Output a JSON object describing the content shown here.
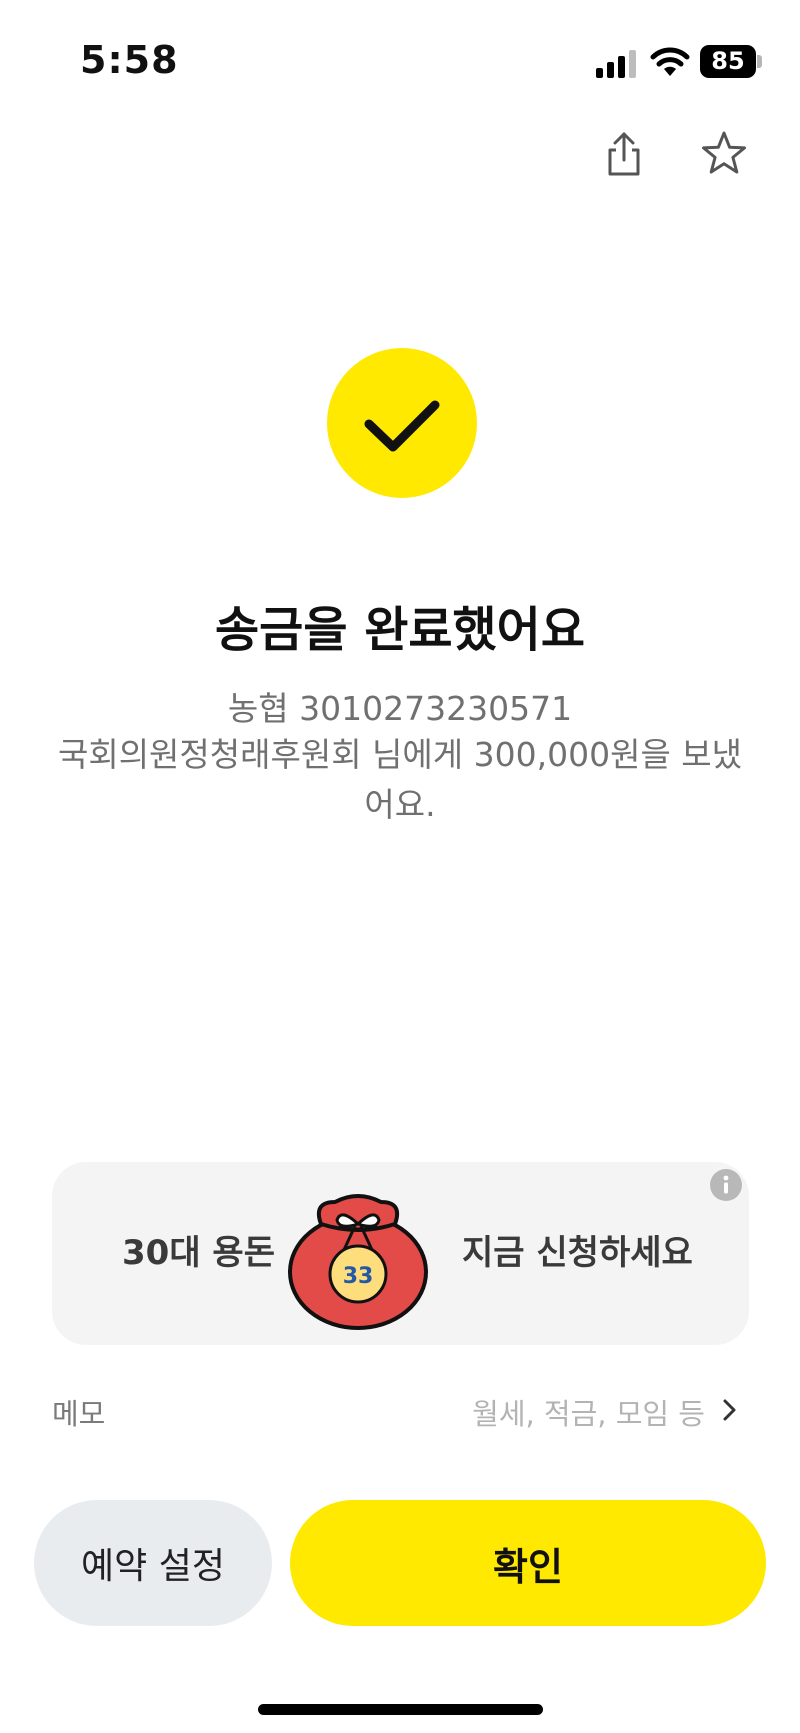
{
  "status_bar": {
    "time": "5:58",
    "battery_level": "85",
    "icons": [
      "signal-icon",
      "wifi-icon",
      "battery-icon"
    ]
  },
  "header": {
    "icons": [
      "share-icon",
      "star-icon"
    ]
  },
  "result": {
    "icon": "check-icon",
    "title": "송금을 완료했어요",
    "account_line": "농협 3010273230571",
    "message": "국회의원정청래후원회 님에게 300,000원을 보냈어요."
  },
  "promo": {
    "left_text": "30대 용돈",
    "right_text": "지금 신청하세요",
    "pouch_label": "33",
    "icons": [
      "lucky-pouch-icon",
      "info-icon"
    ]
  },
  "memo": {
    "label": "메모",
    "placeholder": "월세, 적금, 모임 등",
    "icon": "chevron-right-icon"
  },
  "buttons": {
    "reserve_label": "예약 설정",
    "confirm_label": "확인"
  },
  "colors": {
    "accent": "#FFE900",
    "secondary_button": "#e9ecef",
    "card_bg": "#f4f4f4",
    "pouch_red": "#E24B47"
  }
}
